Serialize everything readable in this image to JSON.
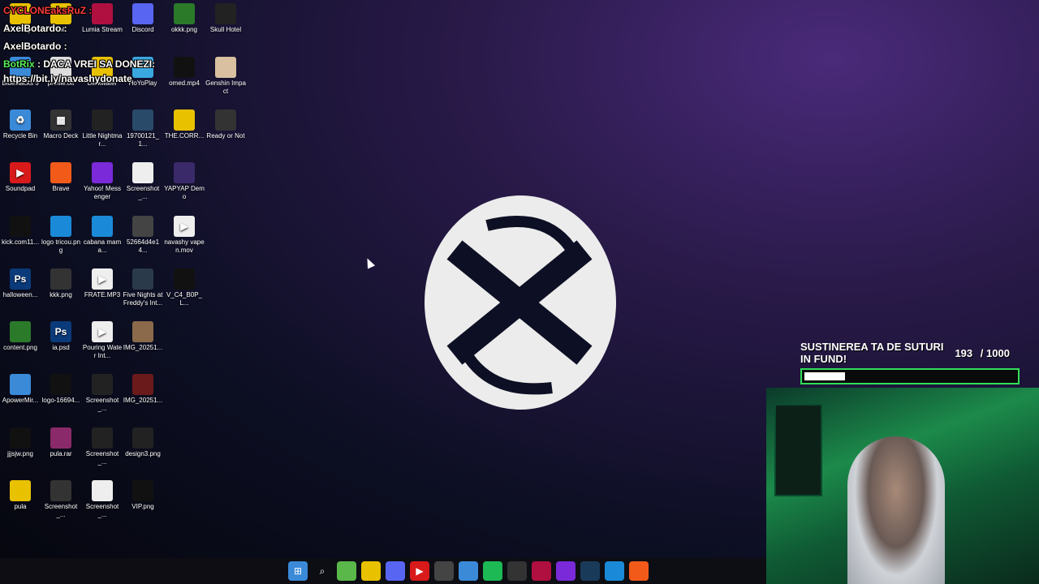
{
  "desktop_icons": [
    {
      "label": "Messenger",
      "color": "#e8c100",
      "icon": "folder-icon",
      "glyph": ""
    },
    {
      "label": "lol",
      "color": "#e8c100",
      "icon": "folder-icon",
      "glyph": ""
    },
    {
      "label": "Lumia Stream",
      "color": "#b01040",
      "icon": "lumia-icon",
      "glyph": ""
    },
    {
      "label": "Discord",
      "color": "#5865f2",
      "icon": "discord-icon",
      "glyph": ""
    },
    {
      "label": "okkk.png",
      "color": "#2a7a2a",
      "icon": "image-icon",
      "glyph": ""
    },
    {
      "label": "Skull Hotel",
      "color": "#222",
      "icon": "skull-icon",
      "glyph": ""
    },
    {
      "label": "Bluestacks 5",
      "color": "#3a8ad8",
      "icon": "bluestacks-icon",
      "glyph": ""
    },
    {
      "label": "profile.txt",
      "color": "#dddddd",
      "icon": "text-file-icon",
      "glyph": ""
    },
    {
      "label": "Darkwater",
      "color": "#e8c100",
      "icon": "folder-icon",
      "glyph": ""
    },
    {
      "label": "HoYoPlay",
      "color": "#3aa8e0",
      "icon": "hoyoplay-icon",
      "glyph": ""
    },
    {
      "label": "omed.mp4",
      "color": "#111",
      "icon": "video-icon",
      "glyph": ""
    },
    {
      "label": "Genshin Impact",
      "color": "#d8c0a0",
      "icon": "genshin-icon",
      "glyph": ""
    },
    {
      "label": "Recycle Bin",
      "color": "#3a8ad8",
      "icon": "recycle-bin-icon",
      "glyph": "♻"
    },
    {
      "label": "Macro Deck",
      "color": "#333",
      "icon": "macro-deck-icon",
      "glyph": "▦"
    },
    {
      "label": "Little Nightmar...",
      "color": "#222",
      "icon": "little-nightmares-icon",
      "glyph": ""
    },
    {
      "label": "19700121_1...",
      "color": "#2a4a6a",
      "icon": "image-icon",
      "glyph": ""
    },
    {
      "label": "THE.CORR...",
      "color": "#e8c100",
      "icon": "folder-icon",
      "glyph": ""
    },
    {
      "label": "Ready or Not",
      "color": "#333",
      "icon": "ready-or-not-icon",
      "glyph": ""
    },
    {
      "label": "Soundpad",
      "color": "#d81a1a",
      "icon": "soundpad-icon",
      "glyph": "▶"
    },
    {
      "label": "Brave",
      "color": "#f25a1a",
      "icon": "brave-icon",
      "glyph": ""
    },
    {
      "label": "Yahoo! Messenger",
      "color": "#7a2ad8",
      "icon": "yahoo-icon",
      "glyph": ""
    },
    {
      "label": "Screenshot_...",
      "color": "#eeeeee",
      "icon": "image-icon",
      "glyph": ""
    },
    {
      "label": "YAPYAP Demo",
      "color": "#3a2a6a",
      "icon": "yapyap-icon",
      "glyph": ""
    },
    {
      "label": "kick.com11...",
      "color": "#111",
      "icon": "image-icon",
      "glyph": ""
    },
    {
      "label": "logo tricou.png",
      "color": "#1a8ad8",
      "icon": "image-icon",
      "glyph": ""
    },
    {
      "label": "cabana mama...",
      "color": "#1a8ad8",
      "icon": "image-icon",
      "glyph": ""
    },
    {
      "label": "52664d4e14...",
      "color": "#444",
      "icon": "image-icon",
      "glyph": ""
    },
    {
      "label": "navashy vapen.mov",
      "color": "#eeeeee",
      "icon": "video-icon",
      "glyph": "▶"
    },
    {
      "label": "halloween...",
      "color": "#0a3a7a",
      "icon": "photoshop-icon",
      "glyph": "Ps"
    },
    {
      "label": "kkk.png",
      "color": "#333",
      "icon": "image-icon",
      "glyph": ""
    },
    {
      "label": "FRATE.MP3",
      "color": "#eeeeee",
      "icon": "audio-icon",
      "glyph": "▶"
    },
    {
      "label": "Five Nights at Freddy's Int...",
      "color": "#2a3a4a",
      "icon": "fnaf-icon",
      "glyph": ""
    },
    {
      "label": "V_C4_B0P_L...",
      "color": "#111",
      "icon": "image-icon",
      "glyph": ""
    },
    {
      "label": "content.png",
      "color": "#2a7a2a",
      "icon": "image-icon",
      "glyph": ""
    },
    {
      "label": "ia.psd",
      "color": "#0a3a7a",
      "icon": "photoshop-icon",
      "glyph": "Ps"
    },
    {
      "label": "Pouring Water Int...",
      "color": "#eeeeee",
      "icon": "video-icon",
      "glyph": "▶"
    },
    {
      "label": "IMG_20251...",
      "color": "#8a6a4a",
      "icon": "image-icon",
      "glyph": ""
    },
    {
      "label": "ApowerMir...",
      "color": "#3a8ad8",
      "icon": "apowermirror-icon",
      "glyph": ""
    },
    {
      "label": "logo-16694...",
      "color": "#111",
      "icon": "image-icon",
      "glyph": ""
    },
    {
      "label": "Screenshot_...",
      "color": "#222",
      "icon": "image-icon",
      "glyph": ""
    },
    {
      "label": "IMG_20251...",
      "color": "#6a1a1a",
      "icon": "image-icon",
      "glyph": ""
    },
    {
      "label": "jjjsjw.png",
      "color": "#111",
      "icon": "image-icon",
      "glyph": ""
    },
    {
      "label": "pula.rar",
      "color": "#8a2a6a",
      "icon": "winrar-icon",
      "glyph": ""
    },
    {
      "label": "Screenshot_...",
      "color": "#222",
      "icon": "image-icon",
      "glyph": ""
    },
    {
      "label": "design3.png",
      "color": "#222",
      "icon": "image-icon",
      "glyph": ""
    },
    {
      "label": "pula",
      "color": "#e8c100",
      "icon": "folder-icon",
      "glyph": ""
    },
    {
      "label": "Screenshot_...",
      "color": "#333",
      "icon": "image-icon",
      "glyph": ""
    },
    {
      "label": "Screenshot_...",
      "color": "#eeeeee",
      "icon": "image-icon",
      "glyph": ""
    },
    {
      "label": "VIP.png",
      "color": "#111",
      "icon": "image-icon",
      "glyph": ""
    }
  ],
  "chat": {
    "lines": [
      {
        "user": "CYCLONEaksRuZ :",
        "text": ""
      },
      {
        "user": "AxelBotardo :",
        "text": ""
      },
      {
        "user": "AxelBotardo :",
        "text": ""
      },
      {
        "user": "BotRix",
        "text": ": DACA VREI SA DONEZI:"
      }
    ],
    "link": "https://bit.ly/navashydonate"
  },
  "goal": {
    "title": "SUSTINEREA TA DE SUTURI IN FUND!",
    "current": "193",
    "target": "/ 1000",
    "fraction": 0.193
  },
  "taskbar": [
    {
      "name": "start-button-icon",
      "color": "#3a8ad8",
      "glyph": "⊞"
    },
    {
      "name": "search-icon",
      "color": "transparent",
      "glyph": "⌕"
    },
    {
      "name": "notepad-icon",
      "color": "#5ab84a",
      "glyph": ""
    },
    {
      "name": "file-explorer-icon",
      "color": "#e8c100",
      "glyph": ""
    },
    {
      "name": "discord-icon",
      "color": "#5865f2",
      "glyph": ""
    },
    {
      "name": "youtube-icon",
      "color": "#d81a1a",
      "glyph": "▶"
    },
    {
      "name": "obs-icon",
      "color": "#444",
      "glyph": ""
    },
    {
      "name": "chrome-icon",
      "color": "#3a8ad8",
      "glyph": ""
    },
    {
      "name": "spotify-icon",
      "color": "#1db954",
      "glyph": ""
    },
    {
      "name": "xbox-icon",
      "color": "#333",
      "glyph": ""
    },
    {
      "name": "lumia-icon",
      "color": "#b01040",
      "glyph": ""
    },
    {
      "name": "game-icon",
      "color": "#7a2ad8",
      "glyph": ""
    },
    {
      "name": "steam-icon",
      "color": "#1a3a5a",
      "glyph": ""
    },
    {
      "name": "app-icon",
      "color": "#1a8ad8",
      "glyph": ""
    },
    {
      "name": "brave-icon",
      "color": "#f25a1a",
      "glyph": ""
    }
  ]
}
